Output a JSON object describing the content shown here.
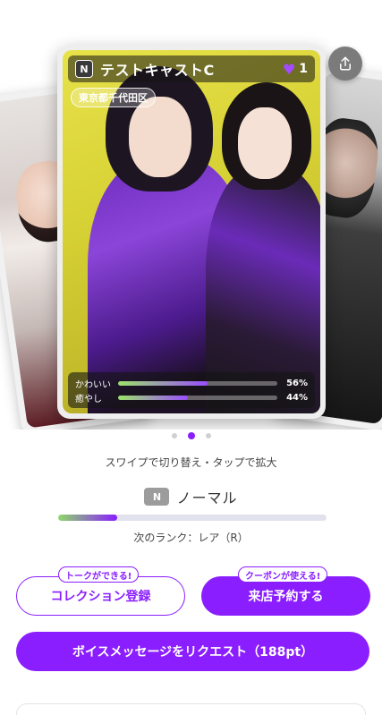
{
  "card": {
    "rarity": "N",
    "name": "テストキャストC",
    "likes": "1",
    "area": "東京都千代田区",
    "stats": [
      {
        "label": "かわいい",
        "value": "56%",
        "level": 0.56
      },
      {
        "label": "癒やし",
        "value": "44%",
        "level": 0.44
      }
    ]
  },
  "carousel": {
    "hint": "スワイプで切り替え・タップで拡大",
    "page_count": 3,
    "active_index": 1
  },
  "rank": {
    "badge": "N",
    "name": "ノーマル",
    "progress": 0.22,
    "next_rank_text": "次のランク：レア（R）"
  },
  "actions": {
    "collection_label": "コレクション登録",
    "collection_tag": "トークができる!",
    "visit_label": "来店予約する",
    "visit_tag": "クーポンが使える!",
    "voice_label": "ボイスメッセージをリクエスト（188pt）"
  },
  "colors": {
    "accent": "#8a1eff",
    "rank_badge": "#9c9c9c"
  },
  "icons": {
    "share": "share-icon",
    "heart": "heart-icon"
  }
}
